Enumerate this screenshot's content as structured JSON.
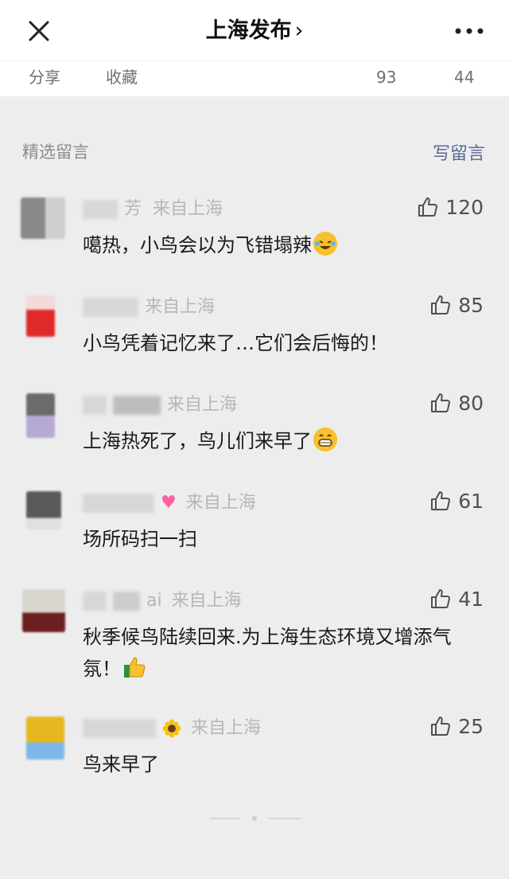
{
  "header": {
    "title": "上海发布",
    "chevron": "›",
    "close_icon": "close-icon",
    "more_icon": "more-icon"
  },
  "actions": {
    "share": "分享",
    "favorite": "收藏",
    "count_a": "93",
    "count_b": "44"
  },
  "comments_section": {
    "title": "精选留言",
    "write": "写留言"
  },
  "comments": [
    {
      "nick": "芳",
      "location": "来自上海",
      "likes": "120",
      "text": "噶热，小鸟会以为飞错塌辣",
      "emoji": "laughing-tears-emoji",
      "avatar_colors": [
        "#8a8a8a",
        "#cfcfcf"
      ]
    },
    {
      "nick": "",
      "location": "来自上海",
      "likes": "85",
      "text": "小鸟凭着记忆来了…它们会后悔的！",
      "emoji": "",
      "avatar_colors": [
        "#f3d9d7",
        "#e02a2a"
      ]
    },
    {
      "nick": "",
      "location": "来自上海",
      "likes": "80",
      "text": "上海热死了，鸟儿们来早了",
      "emoji": "grinning-emoji",
      "avatar_colors": [
        "#6b6b6b",
        "#b7a9d6"
      ]
    },
    {
      "nick": "",
      "location": "来自上海",
      "likes": "61",
      "text": "场所码扫一扫",
      "emoji": "",
      "avatar_colors": [
        "#5a5a5a",
        "#e0e0e0"
      ]
    },
    {
      "nick": "ai",
      "location": "来自上海",
      "likes": "41",
      "text": "秋季候鸟陆续回来.为上海生态环境又增添气氛！",
      "emoji": "thumbs-up-emoji",
      "avatar_colors": [
        "#d8d6ce",
        "#6b1f1f"
      ]
    },
    {
      "nick": "",
      "location": "来自上海",
      "likes": "25",
      "text": "鸟来早了",
      "emoji": "",
      "avatar_colors": [
        "#e6b820",
        "#7db7ea"
      ]
    }
  ]
}
